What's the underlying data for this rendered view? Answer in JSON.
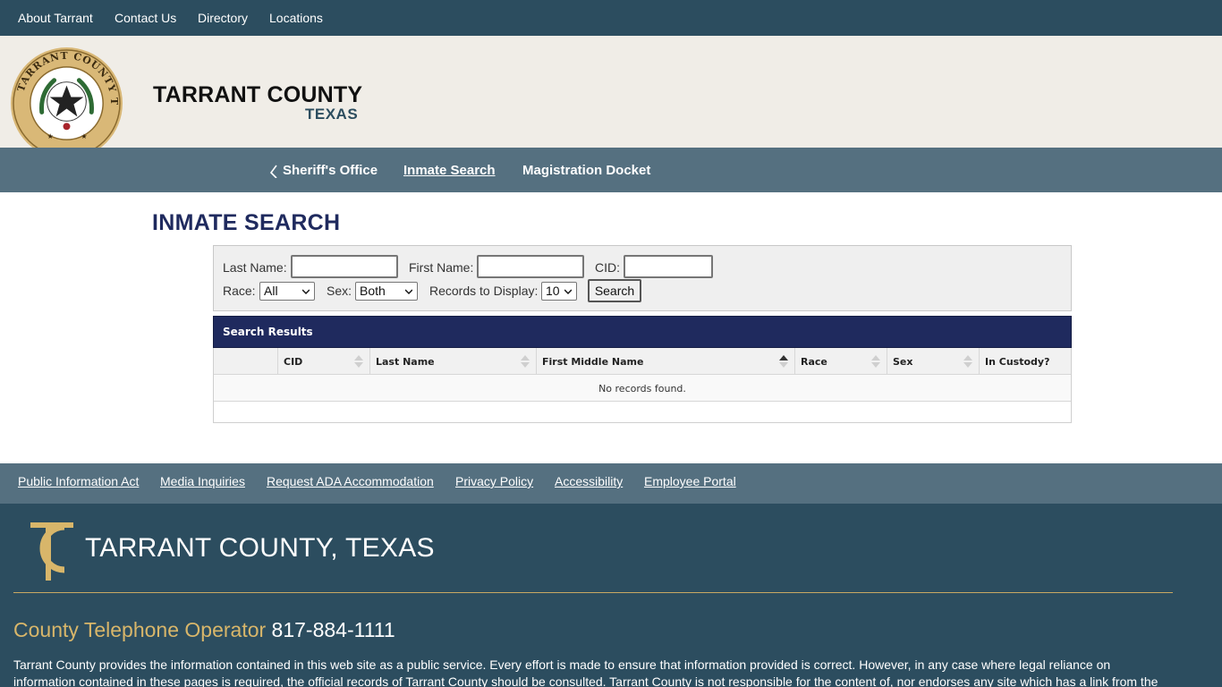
{
  "topnav": {
    "items": [
      "About Tarrant",
      "Contact Us",
      "Directory",
      "Locations"
    ]
  },
  "header": {
    "title": "TARRANT COUNTY",
    "subtitle": "TEXAS",
    "seal_icon": "county-seal-icon",
    "seal_text": "TARRANT COUNTY TEXAS"
  },
  "subnav": {
    "back_icon": "chevron-left-icon",
    "items": [
      "Sheriff's Office",
      "Inmate Search",
      "Magistration Docket"
    ],
    "active": "Inmate Search"
  },
  "page": {
    "title": "INMATE SEARCH"
  },
  "search_form": {
    "last_name_label": "Last Name:",
    "last_name_value": "",
    "first_name_label": "First Name:",
    "first_name_value": "",
    "cid_label": "CID:",
    "cid_value": "",
    "race_label": "Race:",
    "race_value": "All",
    "sex_label": "Sex:",
    "sex_value": "Both",
    "records_label": "Records to Display:",
    "records_value": "10",
    "search_button": "Search"
  },
  "results": {
    "header": "Search Results",
    "columns": [
      "",
      "CID",
      "Last Name",
      "First Middle Name",
      "Race",
      "Sex",
      "In Custody?"
    ],
    "sorted_column": "First Middle Name",
    "empty_message": "No records found."
  },
  "footer_links": [
    "Public Information Act",
    "Media Inquiries",
    "Request ADA Accommodation",
    "Privacy Policy",
    "Accessibility",
    "Employee Portal"
  ],
  "footer": {
    "logo_icon": "tc-monogram-icon",
    "title": "TARRANT COUNTY, TEXAS",
    "operator_label": "County Telephone Operator",
    "operator_phone": "817-884-1111",
    "disclaimer": "Tarrant County provides the information contained in this web site as a public service. Every effort is made to ensure that information provided is correct. However, in any case where legal reliance on information contained in these pages is required, the official records of Tarrant County should be consulted. Tarrant County is not responsible for the content of, nor endorses any site which has a link from the"
  },
  "colors": {
    "topbar": "#2c4d5f",
    "subnav": "#557080",
    "header_bg": "#f0ede7",
    "title_navy": "#1f2a5e",
    "gold": "#d8b66a"
  }
}
